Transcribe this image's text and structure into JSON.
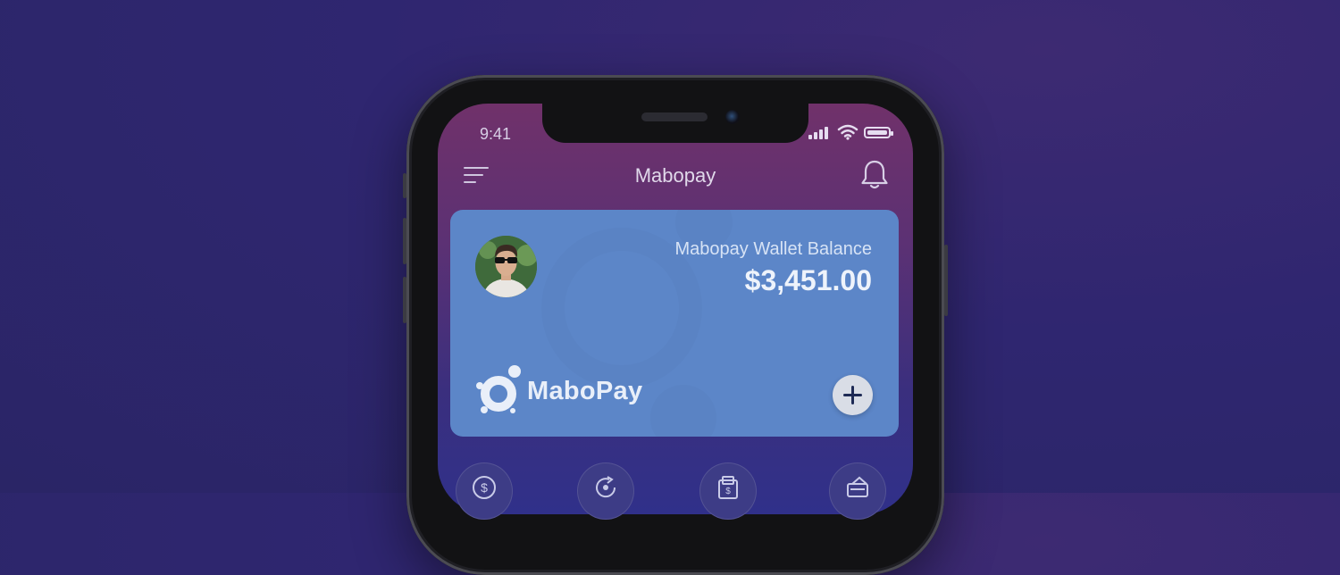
{
  "status_bar": {
    "time": "9:41",
    "icons": [
      "cellular-signal-icon",
      "wifi-icon",
      "battery-icon"
    ]
  },
  "header": {
    "title": "Mabopay",
    "menu_icon": "menu-icon",
    "notifications_icon": "bell-icon"
  },
  "wallet_card": {
    "balance_label": "Mabopay Wallet Balance",
    "balance_amount": "$3,451.00",
    "brand_name": "MaboPay",
    "add_icon": "plus-icon"
  },
  "quick_actions": [
    {
      "icon": "dollar-coin-icon"
    },
    {
      "icon": "refresh-arrow-icon"
    },
    {
      "icon": "wallet-bill-icon"
    },
    {
      "icon": "card-icon"
    }
  ],
  "colors": {
    "background": "#2f2670",
    "card": "#5c86c8",
    "header_gradient_top": "#70316a",
    "accent_dark": "#1e2a55"
  }
}
